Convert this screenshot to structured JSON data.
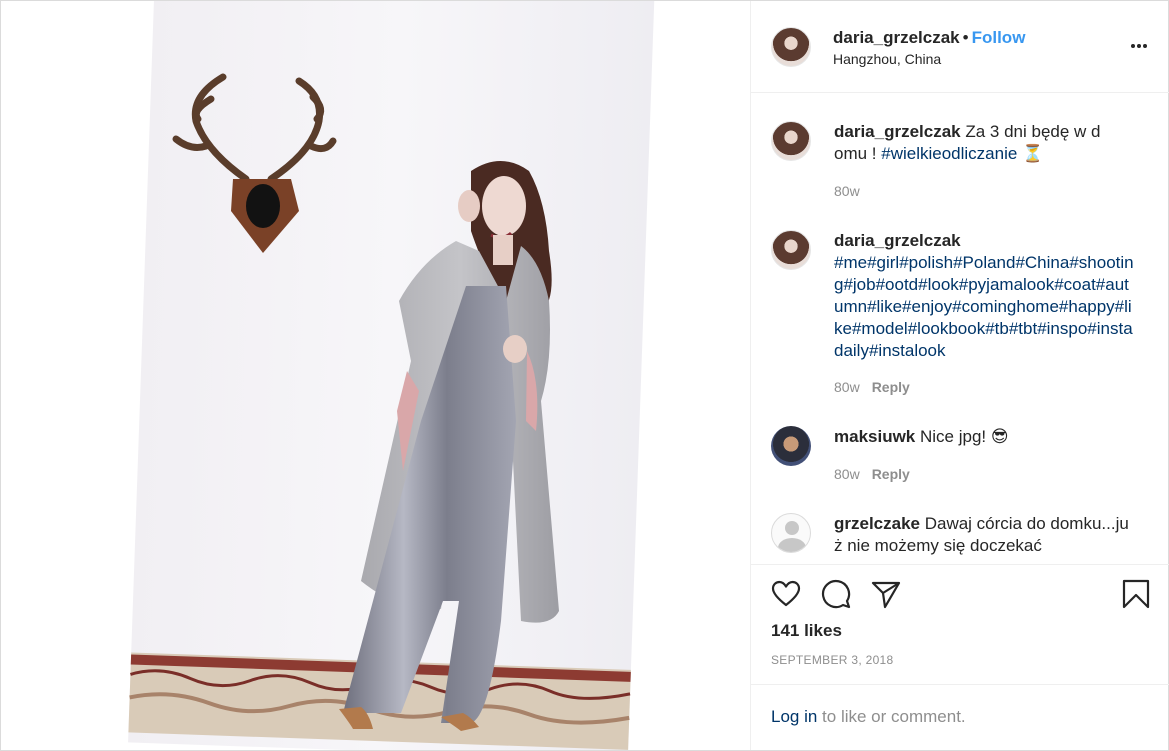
{
  "post": {
    "username": "daria_grzelczak",
    "separator": "•",
    "follow_label": "Follow",
    "location": "Hangzhou, China"
  },
  "comments": [
    {
      "username": "daria_grzelczak",
      "text_before": " Za 3 dni będę w domu ! ",
      "hashtag": "#wielkieodliczanie",
      "emoji": "⏳",
      "age": "80w"
    },
    {
      "username": "daria_grzelczak",
      "tags": "#me#girl#polish#Poland#China#shooting#job#ootd#look#pyjamalook#coat#autumn#like#enjoy#cominghome#happy#like#model#lookbook#tb#tbt#inspo#instadaily#instalook",
      "age": "80w",
      "reply_label": "Reply"
    },
    {
      "username": "maksiuwk",
      "text": " Nice jpg! ",
      "emoji": "😎",
      "age": "80w",
      "reply_label": "Reply"
    },
    {
      "username": "grzelczake",
      "text": " Dawaj córcia do domku...już nie możemy się doczekać"
    }
  ],
  "likes": "141 likes",
  "date": "SEPTEMBER 3, 2018",
  "footer": {
    "login_label": "Log in",
    "login_suffix": " to like or comment."
  },
  "icons": {
    "like": "heart-icon",
    "comment": "comment-icon",
    "share": "paper-plane-icon",
    "save": "bookmark-icon",
    "more": "more-options-icon"
  }
}
